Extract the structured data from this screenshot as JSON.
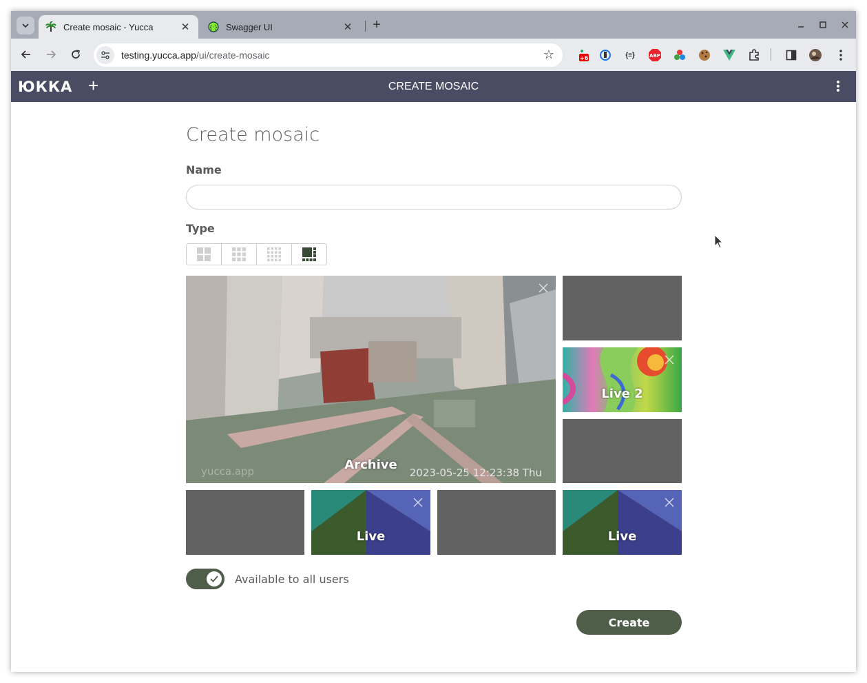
{
  "browser": {
    "tabs": [
      {
        "title": "Create mosaic - Yucca",
        "close": "✕"
      },
      {
        "title": "Swagger UI",
        "close": "✕"
      }
    ],
    "new_tab": "+",
    "url_host": "testing.yucca.app",
    "url_path": "/ui/create-mosaic",
    "ext_badge": "+6",
    "ext_abp": "ABP",
    "ext_json": "{≡}"
  },
  "app": {
    "logo": "ЮККА",
    "add": "+",
    "header_title": "CREATE MOSAIC"
  },
  "form": {
    "title": "Create mosaic",
    "name_label": "Name",
    "name_value": "",
    "type_label": "Type",
    "selected_type_index": 3,
    "cells": [
      {
        "caption": "Archive",
        "stamp": "2023-05-25 12:23:38 Thu",
        "watermark": "yucca.app"
      },
      {
        "caption": ""
      },
      {
        "caption": "Live 2"
      },
      {
        "caption": ""
      },
      {
        "caption": ""
      },
      {
        "caption": "Live"
      },
      {
        "caption": ""
      },
      {
        "caption": "Live"
      }
    ],
    "toggle_label": "Available to all users",
    "toggle_on": true,
    "create_label": "Create"
  },
  "colors": {
    "accent": "#4e5e48",
    "appbar": "#4a4c63",
    "empty_cell": "#626262"
  }
}
